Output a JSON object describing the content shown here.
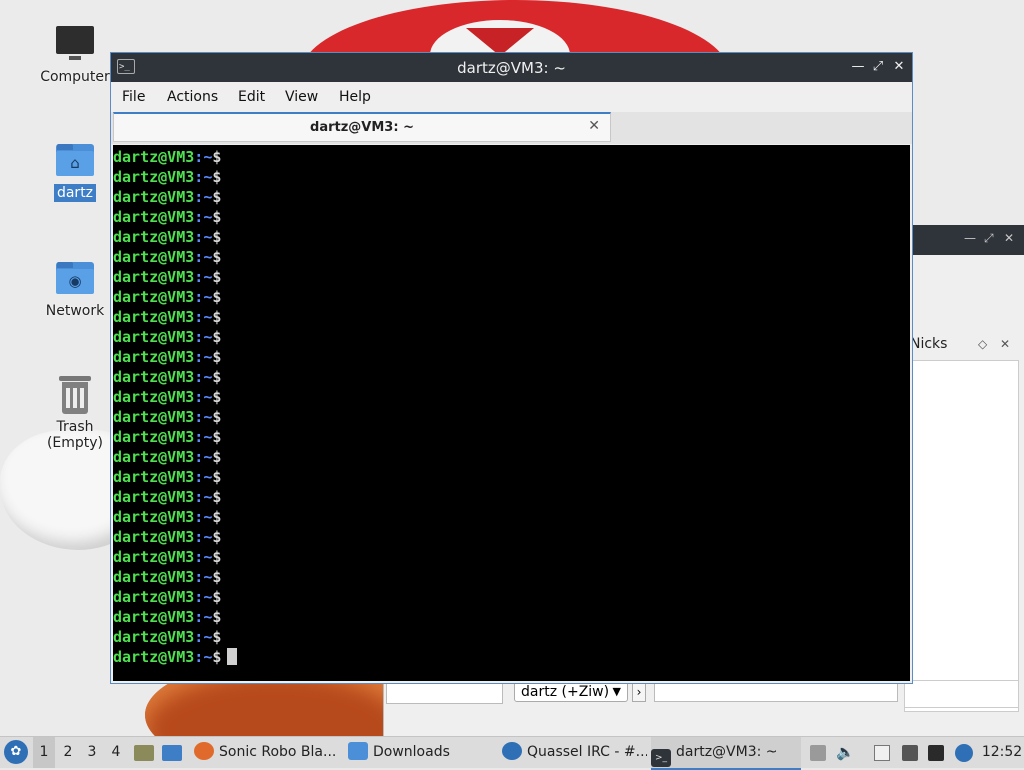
{
  "desktop": {
    "icons": [
      {
        "label": "Computer"
      },
      {
        "label": "dartz"
      },
      {
        "label": "Network"
      },
      {
        "label": "Trash (Empty)"
      }
    ]
  },
  "quassel": {
    "nicks_title": "Nicks",
    "nick_selector": "dartz (+Ziw)"
  },
  "terminal": {
    "title": "dartz@VM3: ~",
    "menu": [
      "File",
      "Actions",
      "Edit",
      "View",
      "Help"
    ],
    "tab_label": "dartz@VM3: ~",
    "prompt_user_host": "dartz@VM3",
    "prompt_sep": ":",
    "prompt_path": "~",
    "prompt_symbol": "$",
    "prompt_line_count": 26
  },
  "taskbar": {
    "workspaces": [
      "1",
      "2",
      "3",
      "4"
    ],
    "active_workspace": "1",
    "tasks": [
      {
        "label": "Sonic Robo Bla..."
      },
      {
        "label": "Downloads"
      },
      {
        "label": "Quassel IRC - #..."
      },
      {
        "label": "dartz@VM3: ~"
      }
    ],
    "clock": "12:52"
  }
}
